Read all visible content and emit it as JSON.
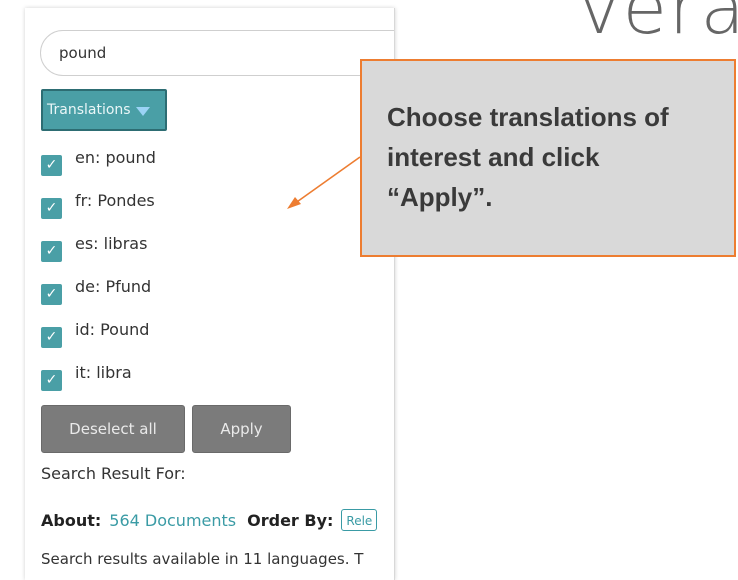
{
  "background_logo": "vera",
  "search": {
    "value": "pound"
  },
  "translations_button": {
    "label": "Translations",
    "icon": "caret-down-icon"
  },
  "translations": [
    {
      "label": "en: pound",
      "checked": true
    },
    {
      "label": "fr: Pondes",
      "checked": true
    },
    {
      "label": "es: libras",
      "checked": true
    },
    {
      "label": "de: Pfund",
      "checked": true
    },
    {
      "label": "id: Pound",
      "checked": true
    },
    {
      "label": "it: libra",
      "checked": true
    }
  ],
  "checkbox_glyph": "✓",
  "buttons": {
    "deselect_all": "Deselect all",
    "apply": "Apply"
  },
  "results": {
    "search_result_for": "Search Result For:",
    "about_label": "About:",
    "documents": "564 Documents",
    "order_by_label": "Order By:",
    "order_by_value": "Rele",
    "availability": "Search results available in 11 languages. T"
  },
  "callout": {
    "text": "Choose translations of interest and click “Apply”."
  },
  "colors": {
    "accent": "#4a9fa6",
    "callout_border": "#ed7d31",
    "callout_fill": "#d9d9d9",
    "button_gray": "#7b7b7b"
  }
}
